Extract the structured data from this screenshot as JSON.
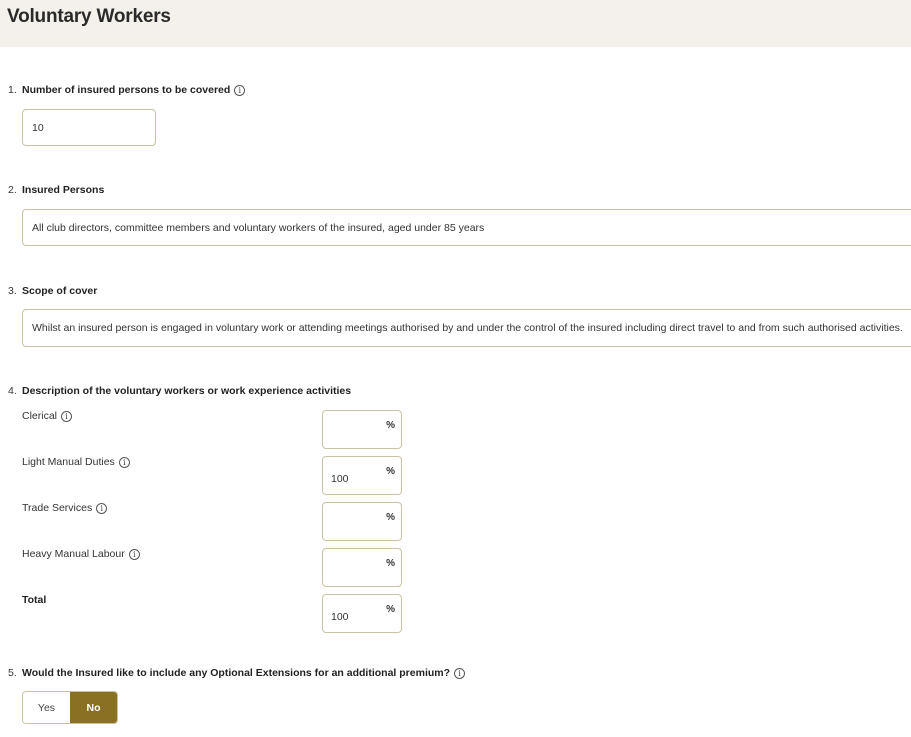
{
  "header": {
    "title": "Voluntary Workers"
  },
  "questions": [
    {
      "number": "1.",
      "label": "Number of insured persons to be covered",
      "value": "10"
    },
    {
      "number": "2.",
      "label": "Insured Persons",
      "value": "All club directors, committee members and voluntary workers of the insured, aged under 85 years"
    },
    {
      "number": "3.",
      "label": "Scope of cover",
      "value": "Whilst an insured person is engaged in voluntary work or attending meetings authorised by and under the control of the insured including direct travel to and from such authorised activities."
    },
    {
      "number": "4.",
      "label": "Description of the voluntary workers or work experience activities"
    },
    {
      "number": "5.",
      "label": "Would the Insured like to include any Optional Extensions for an additional premium?"
    }
  ],
  "activities": [
    {
      "label": "Clerical",
      "value": "",
      "unit": "%"
    },
    {
      "label": "Light Manual Duties",
      "value": "100",
      "unit": "%"
    },
    {
      "label": "Trade Services",
      "value": "",
      "unit": "%"
    },
    {
      "label": "Heavy Manual Labour",
      "value": "",
      "unit": "%"
    }
  ],
  "total": {
    "label": "Total",
    "value": "100",
    "unit": "%"
  },
  "extensions_toggle": {
    "yes_label": "Yes",
    "no_label": "No",
    "selected": "No"
  },
  "colors": {
    "accent": "#8a7023",
    "border": "#c9c3a3",
    "header_bg": "#f4f1ec"
  },
  "icons": {
    "info": "info-icon"
  }
}
